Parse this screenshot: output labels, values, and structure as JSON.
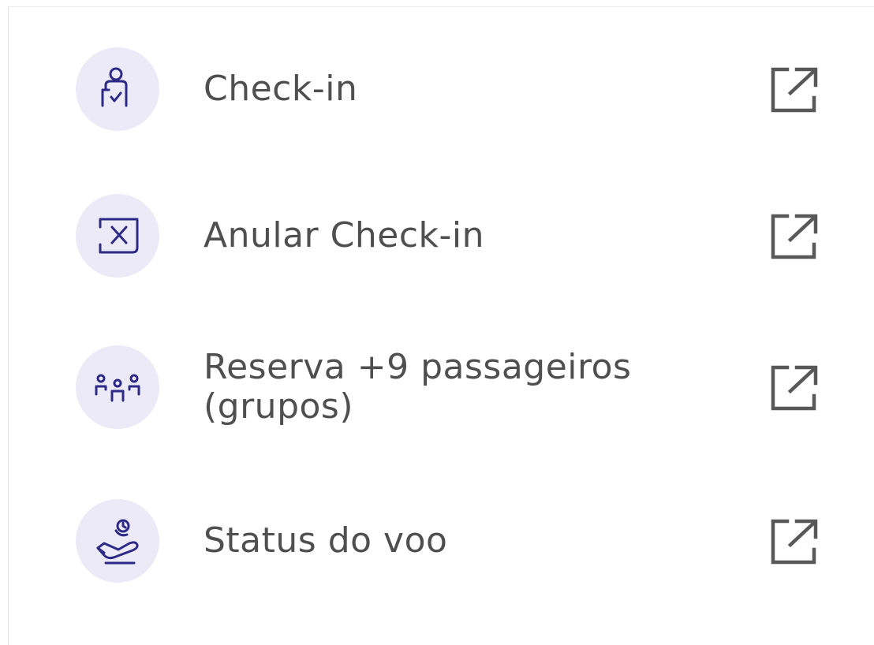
{
  "menu": {
    "items": [
      {
        "label": "Check-in",
        "icon": "person-check-icon",
        "action_icon": "external-link-icon"
      },
      {
        "label": "Anular Check-in",
        "icon": "cancel-checkin-icon",
        "action_icon": "external-link-icon"
      },
      {
        "label": "Reserva +9 passageiros (grupos)",
        "icon": "group-passengers-icon",
        "action_icon": "external-link-icon"
      },
      {
        "label": "Status do voo",
        "icon": "flight-status-icon",
        "action_icon": "external-link-icon"
      }
    ]
  },
  "colors": {
    "icon_stroke": "#2d2a87",
    "icon_background": "#eceaf7",
    "text": "#4f4f4f",
    "external_icon": "#585858"
  }
}
